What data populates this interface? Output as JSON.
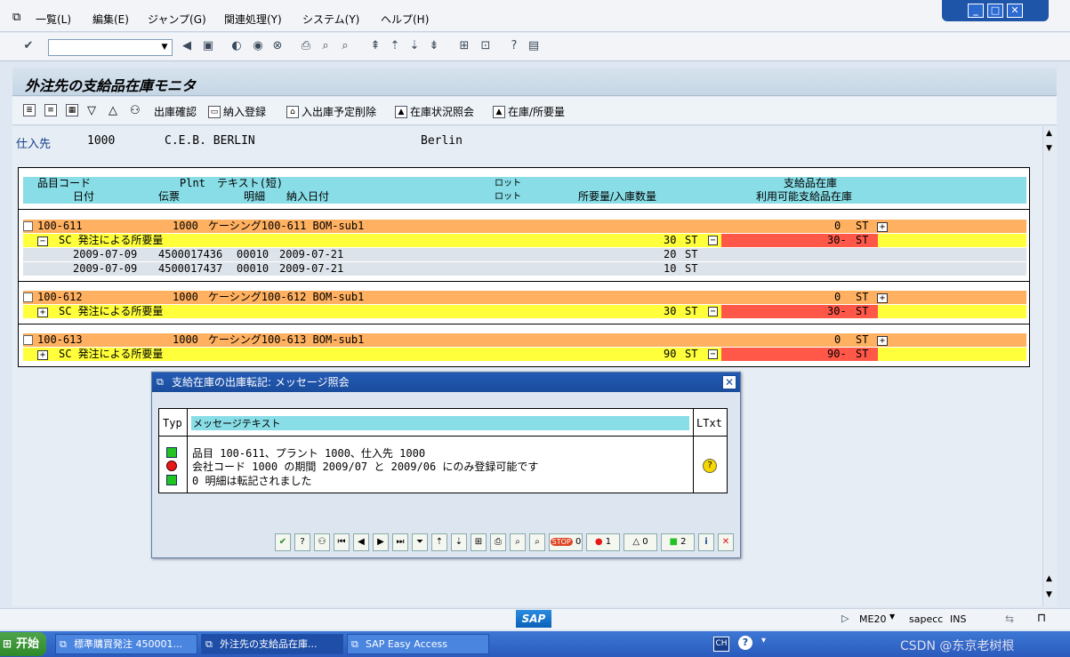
{
  "menu": [
    "一覧(L)",
    "編集(E)",
    "ジャンプ(G)",
    "関連処理(Y)",
    "システム(Y)",
    "ヘルプ(H)"
  ],
  "window_buttons": [
    "_",
    "□",
    "✕"
  ],
  "title": "外注先の支給品在庫モニタ",
  "app_toolbar": {
    "ship_confirm": "出庫確認",
    "goods_receipt": "納入登録",
    "delete_planned": "入出庫予定削除",
    "stock_overview": "在庫状況照会",
    "stock_requirements": "在庫/所要量"
  },
  "vendor": {
    "label": "仕入先",
    "number": "1000",
    "name": "C.E.B. BERLIN",
    "city": "Berlin"
  },
  "grid_header": {
    "material": "品目コード",
    "plant": "Plnt",
    "text": "テキスト(短)",
    "batch1": "ロット",
    "batch2": "ロット",
    "supplied_stock": "支給品在庫",
    "date": "日付",
    "document": "伝票",
    "item": "明細",
    "delivery_date": "納入日付",
    "req_qty": "所要量/入庫数量",
    "available": "利用可能支給品在庫"
  },
  "groups": [
    {
      "material": "100-611",
      "plant": "1000",
      "text": "ケーシング100-611 BOM-sub1",
      "stock": "0",
      "unit": "ST",
      "req_label": "SC 発注による所要量",
      "req_qty": "30",
      "req_unit": "ST",
      "available": "30-",
      "avail_unit": "ST",
      "details": [
        {
          "date": "2009-07-09",
          "doc": "4500017436",
          "item": "00010",
          "delivery": "2009-07-21",
          "qty": "20",
          "unit": "ST"
        },
        {
          "date": "2009-07-09",
          "doc": "4500017437",
          "item": "00010",
          "delivery": "2009-07-21",
          "qty": "10",
          "unit": "ST"
        }
      ]
    },
    {
      "material": "100-612",
      "plant": "1000",
      "text": "ケーシング100-612 BOM-sub1",
      "stock": "0",
      "unit": "ST",
      "req_label": "SC 発注による所要量",
      "req_qty": "30",
      "req_unit": "ST",
      "available": "30-",
      "avail_unit": "ST",
      "details": []
    },
    {
      "material": "100-613",
      "plant": "1000",
      "text": "ケーシング100-613 BOM-sub1",
      "stock": "0",
      "unit": "ST",
      "req_label": "SC 発注による所要量",
      "req_qty": "90",
      "req_unit": "ST",
      "available": "90-",
      "avail_unit": "ST",
      "details": []
    }
  ],
  "dialog": {
    "title": "支給在庫の出庫転記: メッセージ照会",
    "col_type": "Typ",
    "col_text": "メッセージテキスト",
    "col_ltxt": "LTxt",
    "messages": [
      {
        "status": "green",
        "text": "品目 100-611、プラント 1000、仕入先 1000"
      },
      {
        "status": "red",
        "text": "会社コード 1000 の期間 2009/07 と 2009/06 にのみ登録可能です"
      },
      {
        "status": "green",
        "text": "0 明細は転記されました"
      }
    ],
    "counts": {
      "stop": "0",
      "error": "1",
      "warning": "0",
      "success": "2"
    }
  },
  "status": {
    "transaction": "ME20",
    "server": "sapecc",
    "mode": "INS"
  },
  "taskbar": {
    "start": "开始",
    "tasks": [
      "標準購買発注 450001...",
      "外注先の支給品在庫...",
      "SAP Easy Access"
    ],
    "lang": "CH",
    "watermark": "CSDN @东京老树根"
  },
  "colors": {
    "orange": "#ffb060",
    "yellow": "#ffff3c",
    "header": "#88dde6",
    "negative": "#ff5848"
  }
}
